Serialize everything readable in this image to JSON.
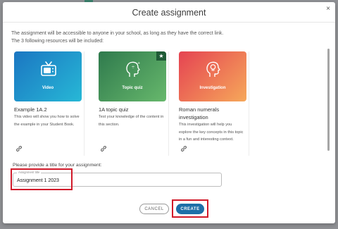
{
  "modal": {
    "title": "Create assignment",
    "close_symbol": "×",
    "intro_line1": "The assignment will be accessible to anyone in your school, as long as they have the correct link.",
    "intro_line2": "The 3 following resources will be included:"
  },
  "cards": [
    {
      "label": "Video",
      "title": "Example 1A.2",
      "desc": "This video will show you how to solve the example in your Student Book.",
      "icon": "tv-icon",
      "gradient": [
        "#1b76c2",
        "#27b8d6"
      ]
    },
    {
      "label": "Topic quiz",
      "title": "1A topic quiz",
      "desc": "Test your knowledge of the content in this section.",
      "icon": "head-math-icon",
      "badge_symbol": "★",
      "gradient": [
        "#2f7a4d",
        "#67b86c"
      ]
    },
    {
      "label": "Investigation",
      "title": "Roman numerals investigation",
      "desc": "This investigation will help you explore the key concepts in this topic in a fun and interesting context.",
      "icon": "head-bulb-icon",
      "gradient": [
        "#e54352",
        "#f6a85a"
      ]
    }
  ],
  "form": {
    "prompt": "Please provide a title for your assignment:",
    "field_label": "Assignment title",
    "field_value": "Assignment 1 2023"
  },
  "buttons": {
    "cancel": "CANCEL",
    "create": "CREATE"
  },
  "colors": {
    "highlight": "#d11a2a",
    "primary": "#1d6fa8"
  }
}
